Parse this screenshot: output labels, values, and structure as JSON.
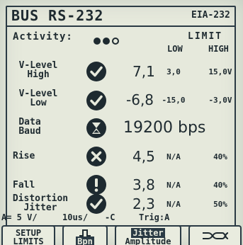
{
  "header": {
    "title": "BUS RS-232",
    "standard": "EIA-232"
  },
  "activity": {
    "label": "Activity:",
    "indicators": [
      "filled",
      "filled",
      "empty"
    ]
  },
  "limit_header": {
    "label": "LIMIT",
    "low": "LOW",
    "high": "HIGH"
  },
  "rows": [
    {
      "label_line1": "V-Level",
      "label_line2": "High",
      "status_icon": "check-icon",
      "value": "7,1",
      "low": "3,0",
      "high": "15,0V"
    },
    {
      "label_line1": "V-Level",
      "label_line2": "Low",
      "status_icon": "check-icon",
      "value": "-6,8",
      "low": "-15,0",
      "high": "-3,0V"
    },
    {
      "label_line1": "Data",
      "label_line2": "Baud",
      "status_icon": "hourglass-icon",
      "value": "19200 bps",
      "low": "",
      "high": ""
    },
    {
      "label_line1": "Rise",
      "label_line2": "",
      "status_icon": "cross-icon",
      "value": "4,5",
      "low": "N/A",
      "high": "40%"
    },
    {
      "label_line1": "Fall",
      "label_line2": "",
      "status_icon": "exclamation-icon",
      "value": "3,8",
      "low": "N/A",
      "high": "40%"
    },
    {
      "label_line1": "Distortion",
      "label_line2": "Jitter",
      "status_icon": "check-icon",
      "value": "2,3",
      "low": "N/A",
      "high": "50%"
    }
  ],
  "status_bar": {
    "channel": "A= 5 V/",
    "timebase": "10us/",
    "coupling": "-C",
    "trigger": "Trig:A"
  },
  "softkeys": [
    {
      "line1": "SETUP",
      "line2": "LIMITS"
    },
    {
      "line1": "",
      "line2": "Bpn"
    },
    {
      "line1": "Jitter",
      "line2": "Amplitude"
    },
    {
      "line1": "",
      "line2": ""
    }
  ],
  "colors": {
    "screen_background": "#e6e9dc",
    "foreground": "#1e2a30"
  }
}
